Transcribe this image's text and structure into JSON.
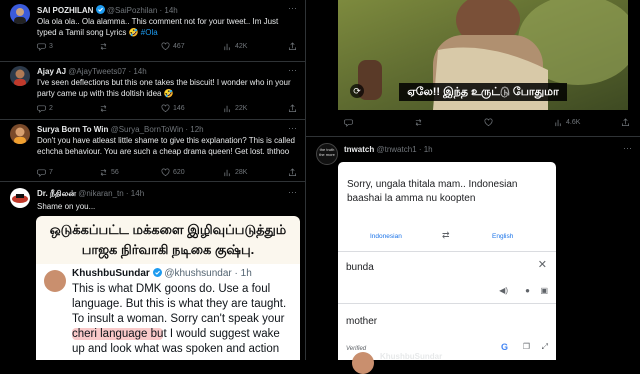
{
  "colors": {
    "background": "#000000",
    "text": "#e7e9ea",
    "muted": "#71767b",
    "link": "#1d9bf0",
    "verified": "#1d9bf0"
  },
  "left": {
    "tweets": [
      {
        "name": "SAI POZHILAN",
        "handle": "@SaiPozhilan · 14h",
        "text_main": "Ola ola ola.. Ola alamma.. This comment not for your tweet.. Im Just typed a Tamil song Lyrics 🤣 ",
        "hashtag": "#Ola",
        "replies": "3",
        "reposts": "",
        "likes": "467",
        "views": "42K"
      },
      {
        "name": "Ajay AJ",
        "handle": "@AjayTweets07 · 14h",
        "text_main": "I've seen deflections but this one takes the biscuit! I wonder who in your party came up with this doltish idea 🤣",
        "replies": "2",
        "reposts": "",
        "likes": "146",
        "views": "22K"
      },
      {
        "name": "Surya Born To Win",
        "handle": "@Surya_BornToWin · 12h",
        "text_main": "Don't you have atleast little shame to give this explanation? This is called echcha behaviour. You are such a cheap drama queen! Get lost. ththoo",
        "replies": "7",
        "reposts": "56",
        "likes": "620",
        "views": "28K"
      },
      {
        "name": "Dr. நீதிலன்",
        "handle": "@nikaran_tn · 14h",
        "text_main": "Shame on you...",
        "card_line1": "ஒடுக்கப்பட்ட மக்களை இழிவுப்படுத்தும்",
        "card_line2": "பாஜக நிர்வாகி நடிகை குஷ்பு.",
        "quoted_name": "KhushbuSundar",
        "quoted_handle": "@khushsundar · 1h",
        "quoted_pre": "This is what DMK goons do. Use a foul language. But this is what they are taught. To insult a woman. Sorry can't speak your ",
        "quoted_highlight": "cheri language bu",
        "quoted_post": "t I would suggest wake up and look what was spoken and action"
      }
    ]
  },
  "right": {
    "video_caption": "ஏலே!! இந்த உருட்டு போதுமா",
    "video_stats": {
      "views": "4.6K"
    },
    "tnwatch": {
      "name": "tnwatch",
      "handle": "@tnwatch1 · 1h",
      "avatar_text": "the truth the more",
      "card_text": "Sorry, ungala thitala mam.. Indonesian baashai la amma nu koopten",
      "source_lang": "Indonesian",
      "target_lang": "English",
      "source_word": "bunda",
      "target_word": "mother",
      "verified_label": "Verified",
      "next_name": "KhushbuSundar"
    }
  }
}
